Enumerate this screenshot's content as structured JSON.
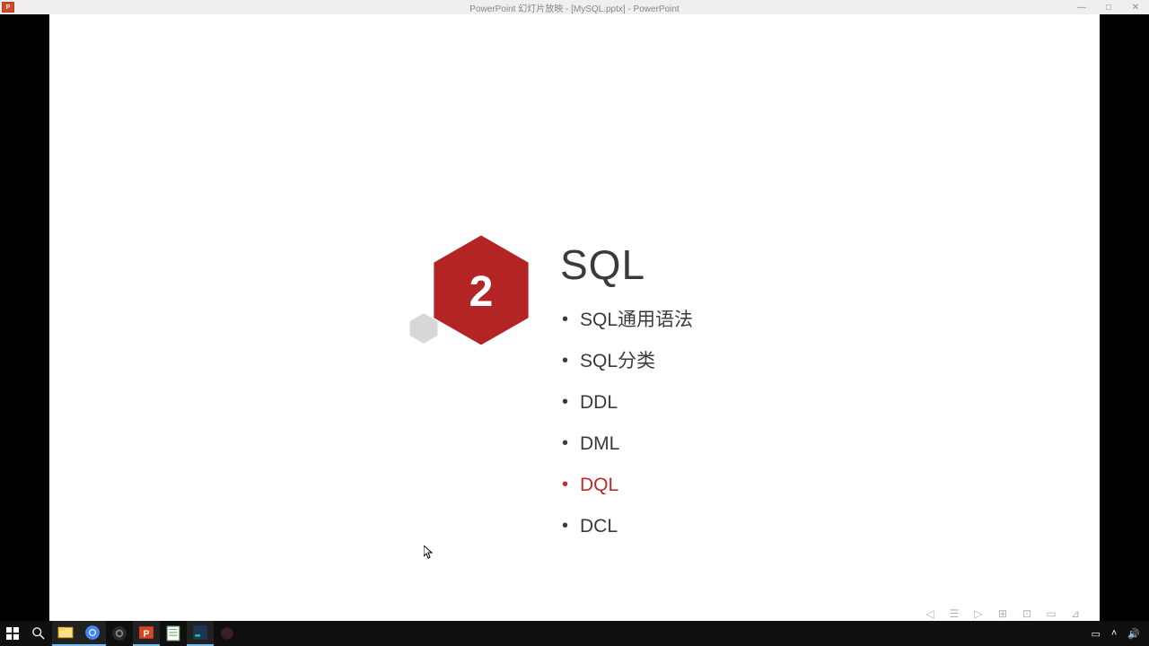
{
  "window": {
    "app_badge": "P",
    "title": "PowerPoint 幻灯片放映 - [MySQL.pptx] - PowerPoint",
    "controls": {
      "min": "—",
      "max": "□",
      "close": "✕"
    }
  },
  "slide": {
    "section_number": "2",
    "heading": "SQL",
    "items": [
      {
        "label": "SQL通用语法",
        "highlight": false
      },
      {
        "label": "SQL分类",
        "highlight": false
      },
      {
        "label": "DDL",
        "highlight": false
      },
      {
        "label": "DML",
        "highlight": false
      },
      {
        "label": "DQL",
        "highlight": true
      },
      {
        "label": "DCL",
        "highlight": false
      }
    ]
  },
  "colors": {
    "hex_main": "#b32424",
    "hex_small": "#d7d7d7",
    "highlight": "#bd2a2a"
  },
  "slide_toolbar": [
    "◁",
    "☰",
    "▷",
    "⊞",
    "⊡",
    "▭",
    "⊿"
  ],
  "taskbar": {
    "tray": {
      "ime": "▭",
      "up": "˄",
      "vol": "🔊"
    }
  }
}
